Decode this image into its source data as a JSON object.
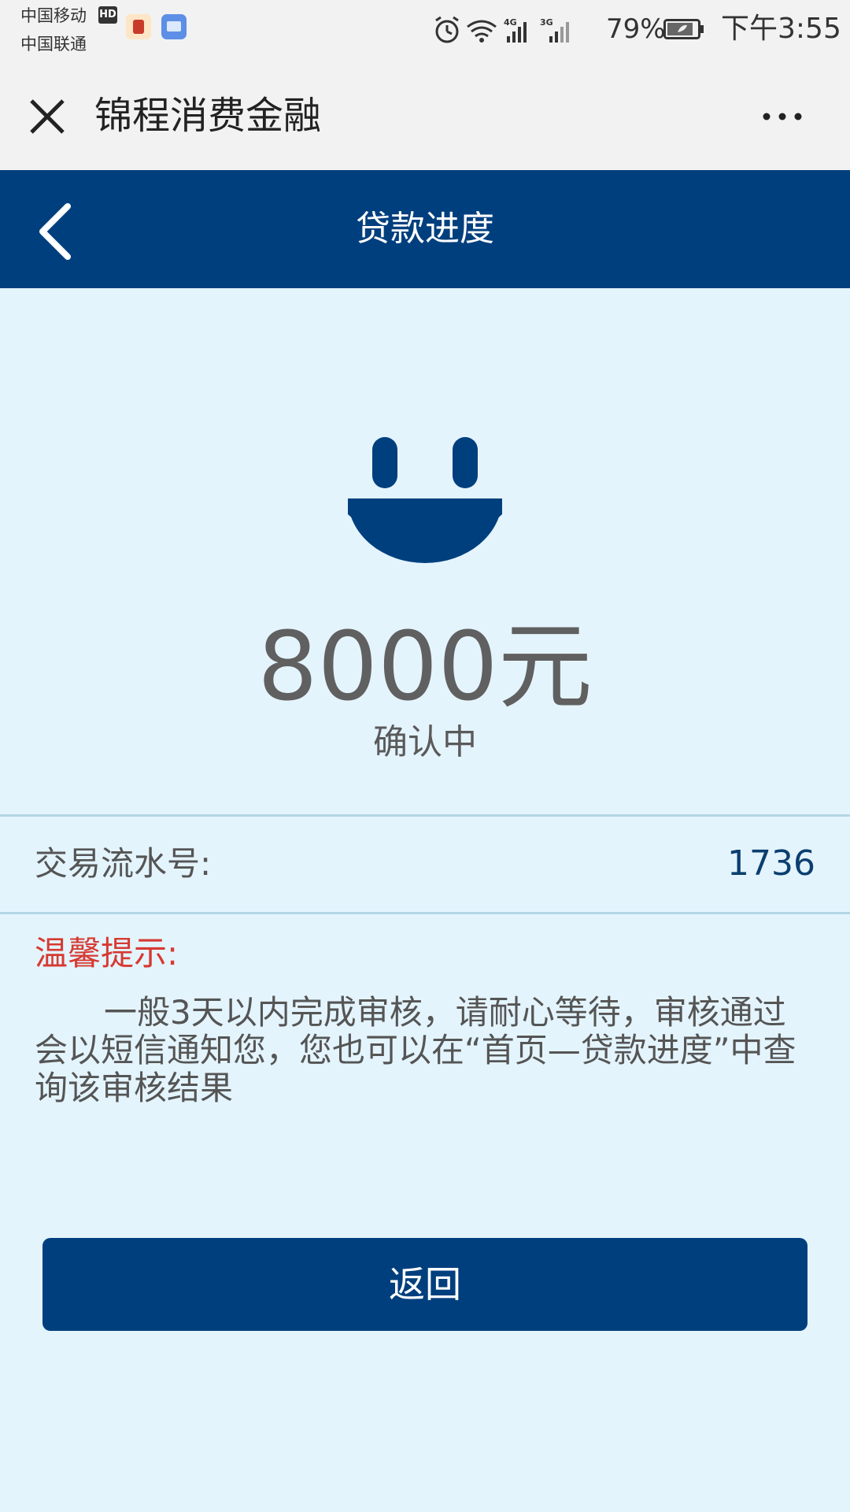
{
  "status_bar": {
    "carrier_1": "中国移动",
    "carrier_1_badge": "HD",
    "carrier_2": "中国联通",
    "battery": "79%",
    "time": "下午3:55",
    "icons": [
      "red-app-icon",
      "card-app-icon",
      "alarm-icon",
      "wifi-icon",
      "signal-4g-icon",
      "signal-3g-icon",
      "battery-icon"
    ],
    "network_labels": [
      "4G",
      "3G"
    ]
  },
  "title_bar": {
    "title": "锦程消费金融",
    "close_icon": "close-icon",
    "more_icon": "more-dots-icon"
  },
  "nav": {
    "title": "贷款进度",
    "back_icon": "chevron-left-icon"
  },
  "result": {
    "icon": "smiley-icon",
    "amount": "8000元",
    "status": "确认中"
  },
  "serial": {
    "label": "交易流水号:",
    "value": "1736"
  },
  "tip": {
    "title": "温馨提示:",
    "body": "一般3天以内完成审核，请耐心等待，审核通过会以短信通知您，您也可以在“首页—贷款进度”中查询该审核结果"
  },
  "actions": {
    "return_label": "返回"
  },
  "colors": {
    "primary": "#003f7e",
    "background": "#e4f4fd",
    "tip_red": "#d63a32",
    "text_gray": "#606060"
  }
}
